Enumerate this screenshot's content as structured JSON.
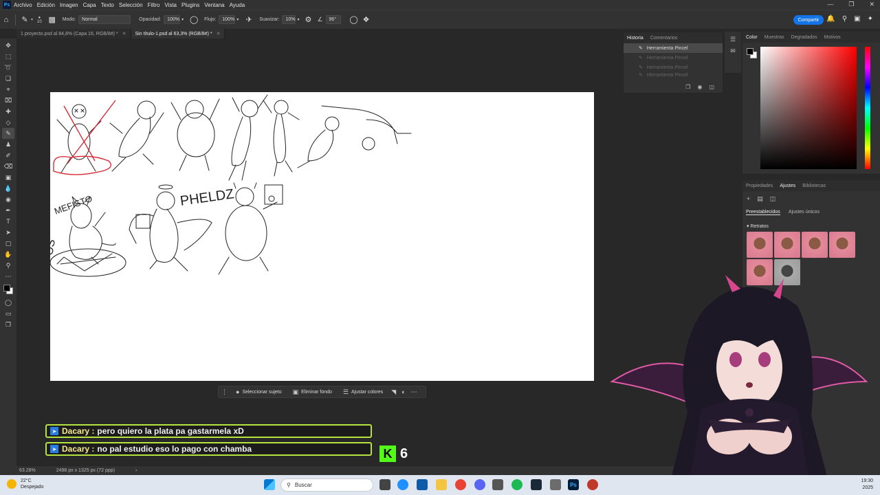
{
  "menu": {
    "logo": "Ps",
    "items": [
      "Archivo",
      "Edición",
      "Imagen",
      "Capa",
      "Texto",
      "Selección",
      "Filtro",
      "Vista",
      "Plugins",
      "Ventana",
      "Ayuda"
    ]
  },
  "options": {
    "brush_size": "10",
    "mode_label": "Modo:",
    "mode_value": "Normal",
    "opacity_label": "Opacidad:",
    "opacity_value": "100%",
    "flow_label": "Flujo:",
    "flow_value": "100%",
    "smooth_label": "Suavizar:",
    "smooth_value": "10%",
    "angle_value": "96°",
    "share_label": "Compartir"
  },
  "tabs": [
    {
      "label": "1 proyecto.psd al 84,8% (Capa 16, RGB/8#) *"
    },
    {
      "label": "Sin título-1.psd al 63,3% (RGB/8#) *"
    }
  ],
  "history": {
    "tab_active": "Historia",
    "tab_other": "Comentarios",
    "rows": [
      "Herramienta Pincel",
      "Herramienta Pincel",
      "Herramienta Pincel",
      "Herramienta Pincel"
    ]
  },
  "color_panel": {
    "tabs": [
      "Color",
      "Muestras",
      "Degradados",
      "Motivos"
    ],
    "fg": "#000000",
    "bg": "#ffffff",
    "hue": "#ff0000"
  },
  "adjust_panel": {
    "tabs": [
      "Propiedades",
      "Ajustes",
      "Bibliotecas"
    ],
    "subtabs": [
      "Preestablecidos",
      "Ajustes únicos"
    ],
    "section": "Retratos"
  },
  "canvas_text": {
    "mefisto": "MEFISTO",
    "pheldz": "PHELDZ",
    "os": "OS"
  },
  "context_bar": {
    "select_subject": "Seleccionar sujeto",
    "remove_bg": "Eliminar fondo",
    "adjust_colors": "Ajustar colores"
  },
  "status": {
    "zoom": "63.28%",
    "dims": "2498 px x 1325 px (72 ppp)"
  },
  "chat": [
    {
      "user": "Dacary :",
      "message": "pero quiero la plata pa gastarmela xD"
    },
    {
      "user": "Dacary :",
      "message": "no pal estudio eso lo pago con chamba"
    }
  ],
  "kick": {
    "logo": "K",
    "count": "6"
  },
  "taskbar": {
    "temp": "22°C",
    "weather": "Despejado",
    "search_placeholder": "Buscar",
    "time": "19:30",
    "date": "2025"
  }
}
